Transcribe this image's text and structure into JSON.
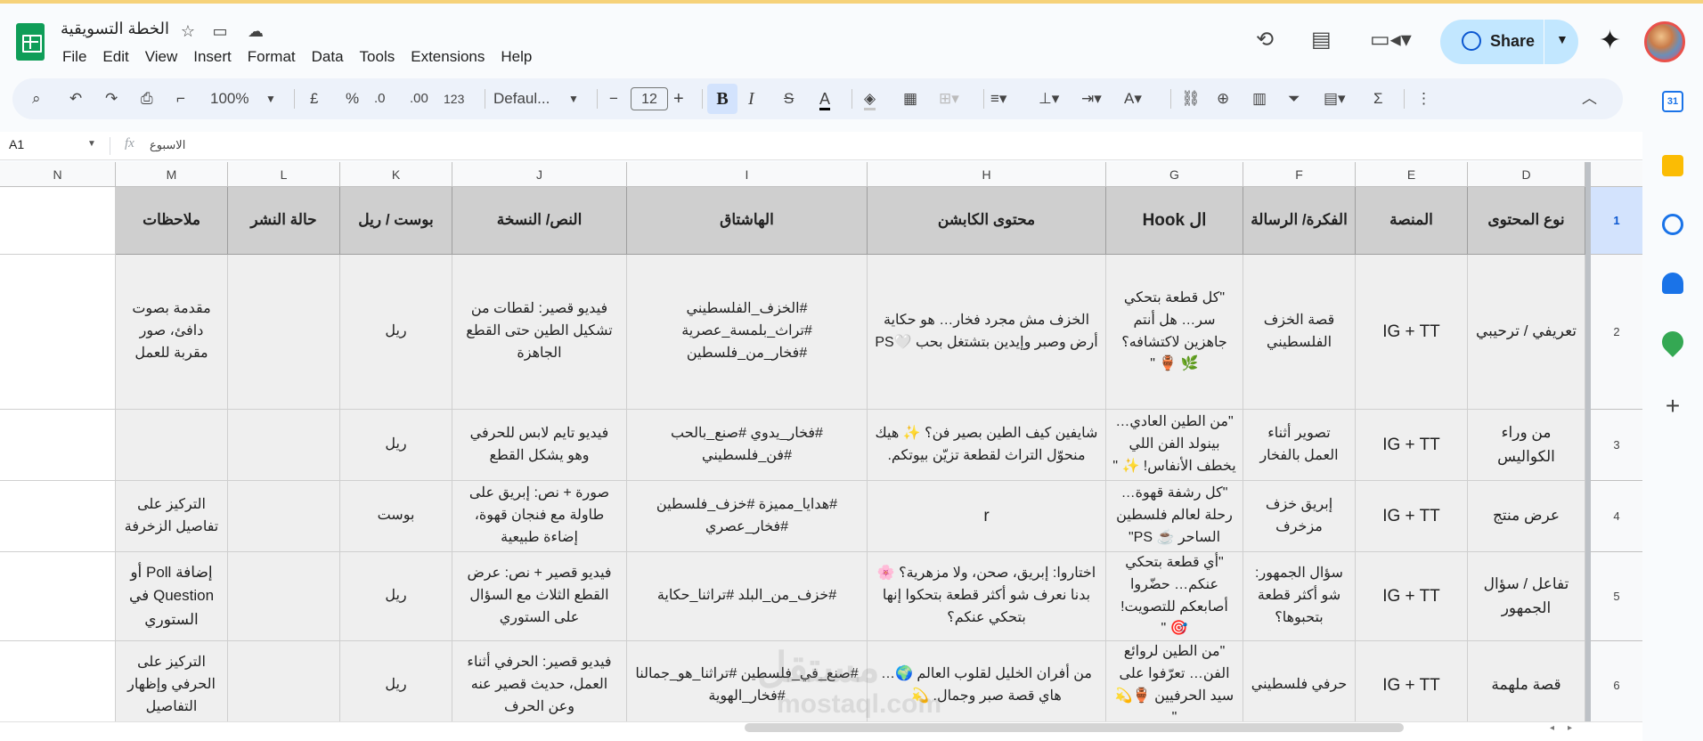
{
  "doc": {
    "title": "الخطة التسويقية",
    "menu": [
      "File",
      "Edit",
      "View",
      "Insert",
      "Format",
      "Data",
      "Tools",
      "Extensions",
      "Help"
    ],
    "share_label": "Share"
  },
  "toolbar": {
    "zoom": "100%",
    "currency": "£",
    "percent": "%",
    "dec_decrease": ".0",
    "dec_increase": ".00",
    "number_format": "123",
    "font": "Defaul...",
    "font_size": "12",
    "bold": "B",
    "italic": "I",
    "strike": "S",
    "text_color": "A"
  },
  "formula": {
    "cell_ref": "A1",
    "fx": "fx",
    "content": "الاسبوع"
  },
  "columns": [
    "N",
    "M",
    "L",
    "K",
    "J",
    "I",
    "H",
    "G",
    "F",
    "E",
    "D"
  ],
  "rows": [
    "1",
    "2",
    "3",
    "4",
    "5",
    "6"
  ],
  "headers": {
    "M": "ملاحظات",
    "L": "حالة النشر",
    "K": "بوست / ريل",
    "J": "النص/ النسخة",
    "I": "الهاشتاق",
    "H": "محتوى الكابشن",
    "G": "ال Hook",
    "F": "الفكرة/ الرسالة",
    "E": "المنصة",
    "D": "نوع المحتوى"
  },
  "table": [
    {
      "M": "مقدمة بصوت دافئ، صور مقربة للعمل",
      "L": "",
      "K": "ريل",
      "J": "فيديو قصير: لقطات من تشكيل الطين حتى القطع الجاهزة",
      "I": "#الخزف_الفلسطيني #تراث_بلمسة_عصرية #فخار_من_فلسطين",
      "H": "الخزف مش مجرد فخار… هو حكاية أرض وصبر وإيدين بتشتغل بحب 🤍PS",
      "G": "\"كل قطعة بتحكي سر… هل أنتم جاهزين لاكتشافه؟ 🌿 🏺 \"",
      "F": "قصة الخزف الفلسطيني",
      "E": "IG + TT",
      "D": "تعريفي / ترحيبي"
    },
    {
      "M": "",
      "L": "",
      "K": "ريل",
      "J": "فيديو تايم لابس للحرفي وهو يشكل القطع",
      "I": "#فخار_يدوي #صنع_بالحب #فن_فلسطيني",
      "H": "شايفين كيف الطين بصير فن؟ ✨ هيك منحوّل التراث لقطعة تزيّن بيوتكم.",
      "G": "\"من الطين العادي… بينولد الفن اللي يخطف الأنفاس! ✨ \"",
      "F": "تصوير أثناء العمل بالفخار",
      "E": "IG + TT",
      "D": "من وراء الكواليس"
    },
    {
      "M": "التركيز على تفاصيل الزخرفة",
      "L": "",
      "K": "بوست",
      "J": "صورة + نص: إبريق على طاولة مع فنجان قهوة، إضاءة طبيعية",
      "I": "#هدايا_مميزة #خزف_فلسطين #فخار_عصري",
      "H": "r",
      "G": "\"كل رشفة قهوة… رحلة لعالم فلسطين الساحر ☕ PS\"",
      "F": "إبريق خزف مزخرف",
      "E": "IG + TT",
      "D": "عرض منتج"
    },
    {
      "M": "إضافة Poll أو Question في الستوري",
      "L": "",
      "K": "ريل",
      "J": "فيديو قصير + نص: عرض القطع الثلاث مع السؤال على الستوري",
      "I": "#خزف_من_البلد #تراثنا_حكاية",
      "H": "اختاروا: إبريق، صحن، ولا مزهرية؟ 🌸 بدنا نعرف شو أكثر قطعة بتحكوا إنها بتحكي عنكم؟",
      "G": "\"أي قطعة بتحكي عنكم… حضّروا أصابعكم للتصويت! 🎯 \"",
      "F": "سؤال الجمهور: شو أكثر قطعة بتحبوها؟",
      "E": "IG + TT",
      "D": "تفاعل / سؤال الجمهور"
    },
    {
      "M": "التركيز على الحرفي وإظهار التفاصيل",
      "L": "",
      "K": "ريل",
      "J": "فيديو قصير: الحرفي أثناء العمل، حديث قصير عنه وعن الحرف",
      "I": "#صنع_في_فلسطين #تراثنا_هو_جمالنا #فخار_الهوية",
      "H": "من أفران الخليل لقلوب العالم 🌍… هاي قصة صبر وجمال. 💫",
      "G": "\"من الطين لروائع الفن… تعرّفوا على سيد الحرفيين 🏺💫 \"",
      "F": "حرفي فلسطيني",
      "E": "IG + TT",
      "D": "قصة ملهمة"
    }
  ],
  "watermark": {
    "arabic": "مستقل",
    "latin": "mostaql.com"
  },
  "colors": {
    "header_fill": "#cfcfcf",
    "body_fill": "#efefef",
    "share_bg": "#c2e7ff",
    "selection": "#d3e3fd",
    "sheets_green": "#0f9d58"
  }
}
